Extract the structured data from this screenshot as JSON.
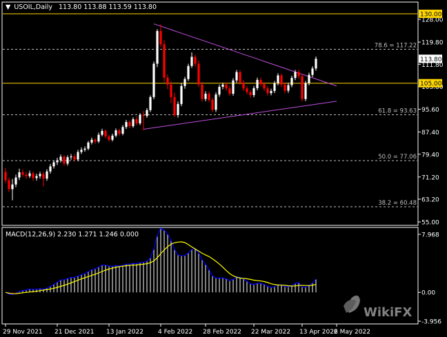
{
  "header": {
    "symbol": "USOIL,Daily",
    "ohlc": "113.80 113.88 113.59 113.80",
    "macd_label": "MACD(12,26,9) 2.230 1.271 1.246 0.000"
  },
  "colors": {
    "background": "#000000",
    "frame": "#ffffff",
    "bull_candle": "#ffffff",
    "bear_candle": "#ff0000",
    "last_candle": "#00ff00",
    "horizontal_level": "#ffd700",
    "trendline": "#c050e0",
    "fib_line": "#c0c0c0",
    "macd_line": "#0000ff",
    "signal_line": "#ffff00",
    "hist_positive": "#ffffff",
    "hist_negative": "#ff0000",
    "price_tag_bg": "#ffffff",
    "level_tag_bg": "#ffd700"
  },
  "chart_data": [
    {
      "type": "candlestick",
      "ylim": [
        55.0,
        132.0
      ],
      "price_ticks": [
        "128.00",
        "119.80",
        "111.80",
        "103.80",
        "95.60",
        "87.40",
        "79.40",
        "71.20",
        "63.20",
        "55.00"
      ],
      "x_ticks": [
        "29 Nov 2021",
        "21 Dec 2021",
        "13 Jan 2022",
        "4 Feb 2022",
        "28 Feb 2022",
        "22 Mar 2022",
        "13 Apr 2022",
        "6 May 2022"
      ],
      "levels": [
        {
          "value": 130.0,
          "label": "130.00"
        },
        {
          "value": 105.0,
          "label": "105.00"
        }
      ],
      "fib_levels": [
        {
          "value": 117.22,
          "label": "78.6 = 117.22"
        },
        {
          "value": 93.63,
          "label": "61.8 = 93.63"
        },
        {
          "value": 77.06,
          "label": "50.0 = 77.06"
        },
        {
          "value": 60.48,
          "label": "38.2 = 60.48"
        }
      ],
      "last_price": "113.80",
      "last_value": 113.8,
      "trendlines": [
        {
          "from_bar": 43,
          "from_value": 126.4,
          "to_bar": 96,
          "to_value": 104.0
        },
        {
          "from_bar": 40,
          "from_value": 88.4,
          "to_bar": 96,
          "to_value": 98.5
        }
      ],
      "bar_count": 104,
      "closes": [
        73.0,
        70.0,
        66.8,
        68.5,
        71.0,
        72.9,
        72.0,
        71.5,
        72.5,
        70.8,
        71.5,
        72.3,
        70.6,
        73.2,
        75.0,
        76.5,
        77.2,
        78.5,
        76.0,
        78.3,
        78.6,
        77.5,
        80.2,
        81.0,
        81.4,
        83.6,
        84.6,
        84.0,
        86.4,
        87.8,
        85.8,
        84.6,
        86.1,
        88.0,
        86.8,
        89.2,
        91.0,
        89.5,
        92.0,
        90.5,
        93.5,
        93.2,
        95.3,
        100.0,
        112.0,
        123.8,
        119.0,
        107.0,
        104.5,
        100.0,
        93.5,
        97.5,
        104.0,
        106.5,
        111.2,
        114.5,
        112.0,
        104.5,
        99.3,
        101.2,
        99.0,
        95.4,
        100.9,
        103.7,
        104.5,
        103.1,
        101.2,
        106.0,
        109.0,
        105.3,
        103.1,
        101.8,
        100.7,
        103.2,
        106.2,
        104.7,
        103.1,
        101.4,
        102.2,
        105.0,
        107.8,
        104.5,
        102.3,
        104.3,
        106.9,
        109.0,
        107.5,
        99.3,
        105.0,
        108.0,
        110.3,
        113.8
      ],
      "candles": [
        {
          "o": 73.0,
          "h": 74.5,
          "l": 69.0,
          "c": 70.0
        },
        {
          "o": 70.0,
          "h": 71.0,
          "l": 65.8,
          "c": 66.8
        },
        {
          "o": 66.8,
          "h": 70.5,
          "l": 62.8,
          "c": 68.5
        },
        {
          "o": 68.5,
          "h": 72.0,
          "l": 67.5,
          "c": 71.0
        },
        {
          "o": 71.0,
          "h": 74.2,
          "l": 70.1,
          "c": 72.9
        },
        {
          "o": 72.9,
          "h": 74.0,
          "l": 71.2,
          "c": 72.0
        },
        {
          "o": 72.0,
          "h": 73.0,
          "l": 70.5,
          "c": 71.5
        },
        {
          "o": 71.5,
          "h": 73.5,
          "l": 70.8,
          "c": 72.5
        },
        {
          "o": 72.5,
          "h": 73.2,
          "l": 69.8,
          "c": 70.8
        },
        {
          "o": 70.8,
          "h": 72.4,
          "l": 69.9,
          "c": 71.5
        },
        {
          "o": 71.5,
          "h": 73.1,
          "l": 70.6,
          "c": 72.3
        },
        {
          "o": 72.3,
          "h": 73.0,
          "l": 67.8,
          "c": 70.6
        },
        {
          "o": 70.6,
          "h": 74.0,
          "l": 69.8,
          "c": 73.2
        },
        {
          "o": 73.2,
          "h": 75.9,
          "l": 72.4,
          "c": 75.0
        },
        {
          "o": 75.0,
          "h": 77.2,
          "l": 74.2,
          "c": 76.5
        },
        {
          "o": 76.5,
          "h": 78.1,
          "l": 75.5,
          "c": 77.2
        },
        {
          "o": 77.2,
          "h": 79.3,
          "l": 76.4,
          "c": 78.5
        },
        {
          "o": 78.5,
          "h": 79.1,
          "l": 75.2,
          "c": 76.0
        },
        {
          "o": 76.0,
          "h": 79.0,
          "l": 75.3,
          "c": 78.3
        },
        {
          "o": 78.3,
          "h": 79.5,
          "l": 77.4,
          "c": 78.6
        },
        {
          "o": 78.6,
          "h": 79.4,
          "l": 76.8,
          "c": 77.5
        },
        {
          "o": 77.5,
          "h": 81.0,
          "l": 76.9,
          "c": 80.2
        },
        {
          "o": 80.2,
          "h": 81.9,
          "l": 79.5,
          "c": 81.0
        },
        {
          "o": 81.0,
          "h": 82.2,
          "l": 80.3,
          "c": 81.4
        },
        {
          "o": 81.4,
          "h": 84.2,
          "l": 80.8,
          "c": 83.6
        },
        {
          "o": 83.6,
          "h": 85.4,
          "l": 82.9,
          "c": 84.6
        },
        {
          "o": 84.6,
          "h": 85.2,
          "l": 83.1,
          "c": 84.0
        },
        {
          "o": 84.0,
          "h": 87.2,
          "l": 83.4,
          "c": 86.4
        },
        {
          "o": 86.4,
          "h": 88.6,
          "l": 85.8,
          "c": 87.8
        },
        {
          "o": 87.8,
          "h": 88.3,
          "l": 85.1,
          "c": 85.8
        },
        {
          "o": 85.8,
          "h": 86.4,
          "l": 83.9,
          "c": 84.6
        },
        {
          "o": 84.6,
          "h": 86.8,
          "l": 84.0,
          "c": 86.1
        },
        {
          "o": 86.1,
          "h": 88.7,
          "l": 85.5,
          "c": 88.0
        },
        {
          "o": 88.0,
          "h": 88.6,
          "l": 86.0,
          "c": 86.8
        },
        {
          "o": 86.8,
          "h": 89.9,
          "l": 86.2,
          "c": 89.2
        },
        {
          "o": 89.2,
          "h": 91.8,
          "l": 88.5,
          "c": 91.0
        },
        {
          "o": 91.0,
          "h": 91.6,
          "l": 88.8,
          "c": 89.5
        },
        {
          "o": 89.5,
          "h": 92.7,
          "l": 88.9,
          "c": 92.0
        },
        {
          "o": 92.0,
          "h": 93.0,
          "l": 89.8,
          "c": 90.5
        },
        {
          "o": 90.5,
          "h": 94.2,
          "l": 89.9,
          "c": 93.5
        },
        {
          "o": 93.5,
          "h": 95.0,
          "l": 88.0,
          "c": 93.2
        },
        {
          "o": 93.2,
          "h": 96.0,
          "l": 92.5,
          "c": 95.3
        },
        {
          "o": 95.3,
          "h": 100.6,
          "l": 94.6,
          "c": 100.0
        },
        {
          "o": 100.0,
          "h": 112.8,
          "l": 99.2,
          "c": 112.0
        },
        {
          "o": 112.0,
          "h": 124.5,
          "l": 110.8,
          "c": 123.8
        },
        {
          "o": 123.8,
          "h": 126.2,
          "l": 118.0,
          "c": 119.0
        },
        {
          "o": 119.0,
          "h": 120.5,
          "l": 105.5,
          "c": 107.0
        },
        {
          "o": 107.0,
          "h": 108.2,
          "l": 102.8,
          "c": 104.5
        },
        {
          "o": 104.5,
          "h": 105.8,
          "l": 97.8,
          "c": 100.0
        },
        {
          "o": 100.0,
          "h": 101.5,
          "l": 92.8,
          "c": 93.5
        },
        {
          "o": 93.5,
          "h": 98.4,
          "l": 92.6,
          "c": 97.5
        },
        {
          "o": 97.5,
          "h": 105.1,
          "l": 96.7,
          "c": 104.0
        },
        {
          "o": 104.0,
          "h": 107.3,
          "l": 103.0,
          "c": 106.5
        },
        {
          "o": 106.5,
          "h": 112.0,
          "l": 105.8,
          "c": 111.2
        },
        {
          "o": 111.2,
          "h": 116.1,
          "l": 110.5,
          "c": 114.5
        },
        {
          "o": 114.5,
          "h": 115.3,
          "l": 111.1,
          "c": 112.0
        },
        {
          "o": 112.0,
          "h": 113.2,
          "l": 103.6,
          "c": 104.5
        },
        {
          "o": 104.5,
          "h": 105.6,
          "l": 98.4,
          "c": 99.3
        },
        {
          "o": 99.3,
          "h": 102.1,
          "l": 98.5,
          "c": 101.2
        },
        {
          "o": 101.2,
          "h": 102.0,
          "l": 98.2,
          "c": 99.0
        },
        {
          "o": 99.0,
          "h": 99.8,
          "l": 94.6,
          "c": 95.4
        },
        {
          "o": 95.4,
          "h": 101.7,
          "l": 94.6,
          "c": 100.9
        },
        {
          "o": 100.9,
          "h": 104.5,
          "l": 100.1,
          "c": 103.7
        },
        {
          "o": 103.7,
          "h": 105.2,
          "l": 102.8,
          "c": 104.5
        },
        {
          "o": 104.5,
          "h": 105.3,
          "l": 102.3,
          "c": 103.1
        },
        {
          "o": 103.1,
          "h": 104.1,
          "l": 100.4,
          "c": 101.2
        },
        {
          "o": 101.2,
          "h": 106.8,
          "l": 100.5,
          "c": 106.0
        },
        {
          "o": 106.0,
          "h": 109.8,
          "l": 105.2,
          "c": 109.0
        },
        {
          "o": 109.0,
          "h": 109.7,
          "l": 104.4,
          "c": 105.3
        },
        {
          "o": 105.3,
          "h": 106.1,
          "l": 102.2,
          "c": 103.1
        },
        {
          "o": 103.1,
          "h": 103.9,
          "l": 100.9,
          "c": 101.8
        },
        {
          "o": 101.8,
          "h": 102.5,
          "l": 99.8,
          "c": 100.7
        },
        {
          "o": 100.7,
          "h": 104.0,
          "l": 99.9,
          "c": 103.2
        },
        {
          "o": 103.2,
          "h": 107.0,
          "l": 102.4,
          "c": 106.2
        },
        {
          "o": 106.2,
          "h": 107.0,
          "l": 103.8,
          "c": 104.7
        },
        {
          "o": 104.7,
          "h": 105.5,
          "l": 102.2,
          "c": 103.1
        },
        {
          "o": 103.1,
          "h": 104.0,
          "l": 100.5,
          "c": 101.4
        },
        {
          "o": 101.4,
          "h": 103.0,
          "l": 100.6,
          "c": 102.2
        },
        {
          "o": 102.2,
          "h": 105.8,
          "l": 101.4,
          "c": 105.0
        },
        {
          "o": 105.0,
          "h": 108.6,
          "l": 104.2,
          "c": 107.8
        },
        {
          "o": 107.8,
          "h": 108.5,
          "l": 103.6,
          "c": 104.5
        },
        {
          "o": 104.5,
          "h": 105.3,
          "l": 101.4,
          "c": 102.3
        },
        {
          "o": 102.3,
          "h": 105.1,
          "l": 101.5,
          "c": 104.3
        },
        {
          "o": 104.3,
          "h": 107.7,
          "l": 103.5,
          "c": 106.9
        },
        {
          "o": 106.9,
          "h": 109.8,
          "l": 106.1,
          "c": 109.0
        },
        {
          "o": 109.0,
          "h": 109.8,
          "l": 106.6,
          "c": 107.5
        },
        {
          "o": 107.5,
          "h": 108.3,
          "l": 98.4,
          "c": 99.3
        },
        {
          "o": 99.3,
          "h": 105.8,
          "l": 98.5,
          "c": 105.0
        },
        {
          "o": 105.0,
          "h": 108.8,
          "l": 104.2,
          "c": 108.0
        },
        {
          "o": 108.0,
          "h": 111.1,
          "l": 107.2,
          "c": 110.3
        },
        {
          "o": 110.3,
          "h": 114.6,
          "l": 109.5,
          "c": 113.8
        }
      ]
    },
    {
      "type": "macd",
      "params": "12,26,9",
      "ylim": [
        -3.956,
        7.968
      ],
      "ticks": [
        "7.968",
        "0.00",
        "-3.956"
      ]
    }
  ],
  "watermark": "WikiFX"
}
